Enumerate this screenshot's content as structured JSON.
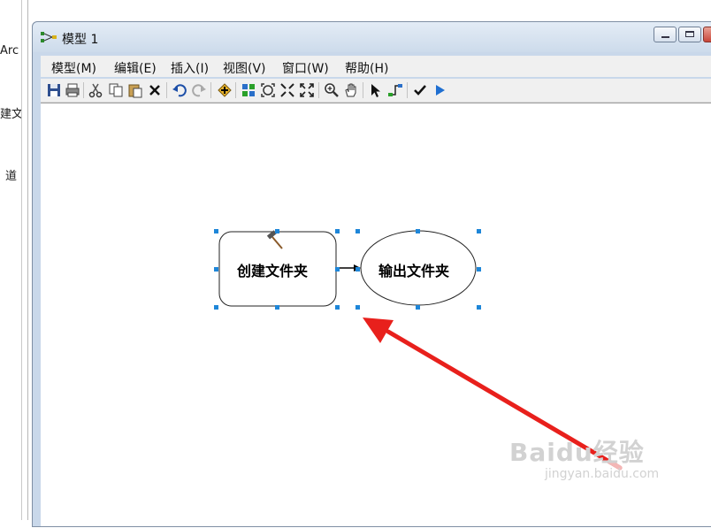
{
  "background": {
    "left_fragments": [
      "Arc",
      "建文件",
      "道"
    ]
  },
  "window": {
    "title": "模型 1",
    "controls": {
      "minimize": "minimize",
      "maximize": "maximize",
      "close": "✕"
    }
  },
  "menu": {
    "items": [
      "模型(M)",
      "编辑(E)",
      "插入(I)",
      "视图(V)",
      "窗口(W)",
      "帮助(H)"
    ]
  },
  "toolbar": {
    "icons": [
      "save-icon",
      "print-icon",
      "cut-icon",
      "copy-icon",
      "paste-icon",
      "delete-icon",
      "undo-icon",
      "redo-icon",
      "add-data-icon",
      "auto-layout-icon",
      "full-extent-icon",
      "zoom-in-fixed-icon",
      "zoom-out-fixed-icon",
      "zoom-icon",
      "pan-icon",
      "select-icon",
      "connect-icon",
      "validate-icon",
      "run-icon"
    ]
  },
  "diagram": {
    "tool_node_label": "创建文件夹",
    "output_node_label": "输出文件夹",
    "selection_color": "#1e86d8",
    "annotation_arrow_color": "#e8201c"
  },
  "watermark": {
    "main": "Baidu经验",
    "sub": "jingyan.baidu.com"
  }
}
